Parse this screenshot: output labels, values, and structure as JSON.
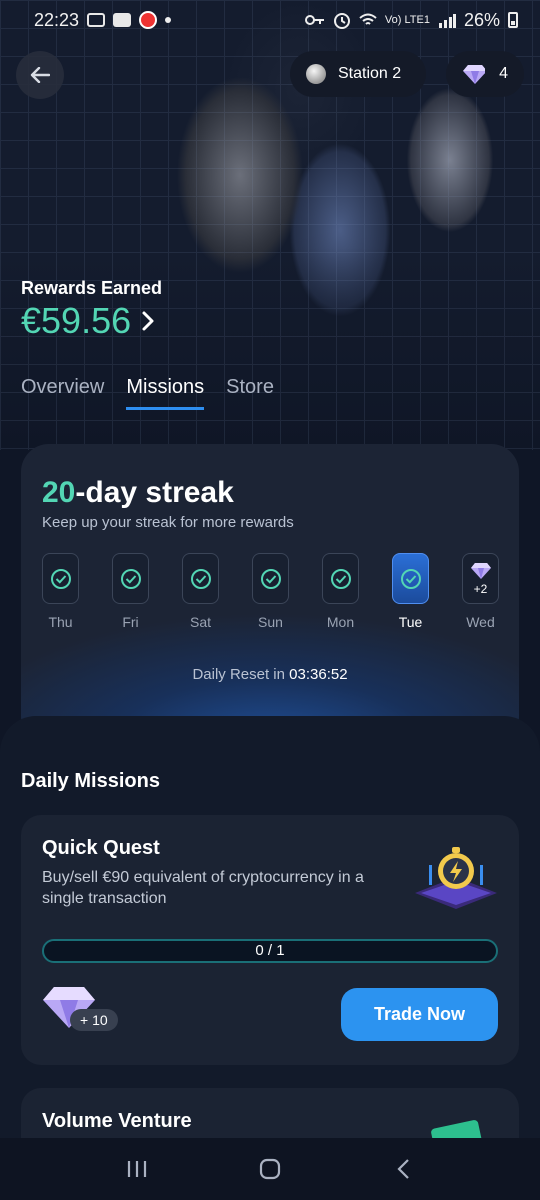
{
  "status_bar": {
    "time": "22:23",
    "network": "Vo) LTE1",
    "battery": "26%"
  },
  "header": {
    "station_label": "Station 2",
    "gem_count": "4"
  },
  "rewards": {
    "title": "Rewards Earned",
    "amount": "€59.56"
  },
  "tabs": [
    {
      "label": "Overview",
      "active": false
    },
    {
      "label": "Missions",
      "active": true
    },
    {
      "label": "Store",
      "active": false
    }
  ],
  "streak": {
    "number": "20",
    "title_suffix": "-day streak",
    "subtitle": "Keep up your streak for more rewards",
    "days": [
      {
        "label": "Thu",
        "state": "done"
      },
      {
        "label": "Fri",
        "state": "done"
      },
      {
        "label": "Sat",
        "state": "done"
      },
      {
        "label": "Sun",
        "state": "done"
      },
      {
        "label": "Mon",
        "state": "done"
      },
      {
        "label": "Tue",
        "state": "today"
      },
      {
        "label": "Wed",
        "state": "reward",
        "reward": "+2"
      }
    ],
    "reset_label": "Daily Reset in",
    "reset_time": "03:36:52"
  },
  "daily_missions": {
    "title": "Daily Missions",
    "missions": [
      {
        "name": "Quick Quest",
        "description": "Buy/sell €90 equivalent of cryptocurrency in a single transaction",
        "progress": "0 / 1",
        "reward": "+ 10",
        "button": "Trade Now"
      },
      {
        "name": "Volume Venture"
      }
    ]
  },
  "colors": {
    "accent_green": "#53d6b4",
    "primary_blue": "#2c93f0",
    "background": "#0f1626"
  }
}
